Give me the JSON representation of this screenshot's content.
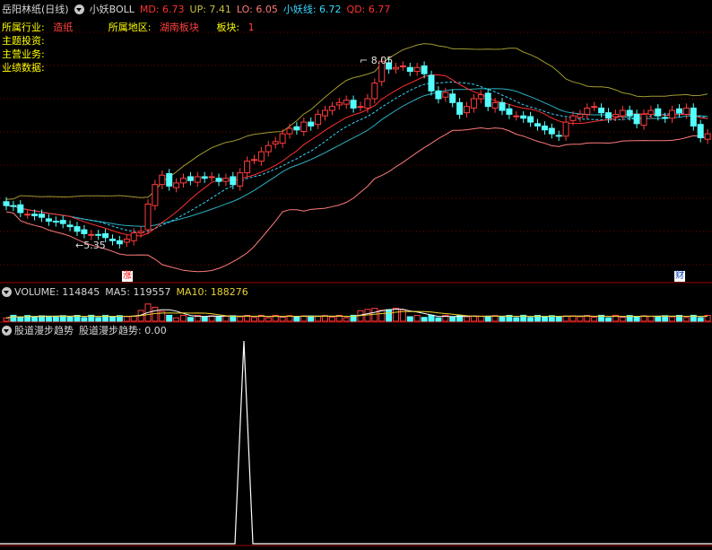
{
  "header": {
    "stock_title": "岳阳林纸(日线)",
    "indicator_name": "小妖BOLL",
    "md": "MD: 6.73",
    "up": "UP: 7.41",
    "lo": "LO: 6.05",
    "xy": "小妖线: 6.72",
    "qd": "QD: 6.77"
  },
  "info": {
    "industry_label": "所属行业:",
    "industry_value": "造纸",
    "region_label": "所属地区:",
    "region_value": "湖南板块",
    "board_label": "板块:",
    "board_value": "1",
    "theme_label": "主题投资:",
    "business_label": "主营业务:",
    "performance_label": "业绩数据:"
  },
  "markers": {
    "high_label": "8.05",
    "low_label": "5.35",
    "zhang_badge": "涨",
    "cai_badge": "财"
  },
  "volume_panel": {
    "volume": "VOLUME: 114845",
    "ma5": "MA5: 119557",
    "ma10": "MA10: 188276"
  },
  "trend_panel": {
    "title": "股道漫步趋势",
    "value_label": "股道漫步趋势: 0.00"
  },
  "colors": {
    "up": "#ff3c3c",
    "down": "#54ffff",
    "md_line": "#ff3030",
    "up_band": "#a09a30",
    "lo_band": "#ff7a7a",
    "mid_line": "#2bb0c0",
    "xy_line": "#38d8ff",
    "vol_ma5": "#ffffff",
    "vol_ma10": "#e8d030",
    "trend_line": "#ffffff",
    "grid": "#7a0000"
  },
  "chart_data": [
    {
      "type": "candlestick",
      "title": "小妖BOLL",
      "series_names": [
        "MD",
        "UP",
        "LO",
        "小妖线",
        "QD"
      ],
      "ylim": [
        5.0,
        8.45
      ],
      "high_marker": 8.05,
      "low_marker": 5.35,
      "closes": [
        5.93,
        5.92,
        5.84,
        5.82,
        5.8,
        5.78,
        5.73,
        5.72,
        5.7,
        5.66,
        5.6,
        5.57,
        5.56,
        5.55,
        5.52,
        5.48,
        5.44,
        5.5,
        5.58,
        5.6,
        5.95,
        6.2,
        6.32,
        6.18,
        6.22,
        6.28,
        6.25,
        6.3,
        6.28,
        6.3,
        6.24,
        6.28,
        6.2,
        6.35,
        6.5,
        6.52,
        6.62,
        6.7,
        6.75,
        6.85,
        6.92,
        6.9,
        7.0,
        6.95,
        7.1,
        7.15,
        7.2,
        7.25,
        7.28,
        7.18,
        7.2,
        7.3,
        7.5,
        7.78,
        7.68,
        7.7,
        7.72,
        7.65,
        7.7,
        7.62,
        7.4,
        7.3,
        7.38,
        7.25,
        7.1,
        7.2,
        7.3,
        7.35,
        7.2,
        7.25,
        7.15,
        7.1,
        7.08,
        7.05,
        7.0,
        6.95,
        6.9,
        6.85,
        6.82,
        7.0,
        7.08,
        7.1,
        7.18,
        7.2,
        7.12,
        7.05,
        7.1,
        7.15,
        7.08,
        6.98,
        7.1,
        7.15,
        7.08,
        7.05,
        7.15,
        7.12,
        7.18,
        6.95,
        6.8,
        6.85
      ]
    },
    {
      "type": "bar",
      "title": "VOLUME",
      "series_names": [
        "VOLUME",
        "MA5",
        "MA10"
      ],
      "volume": 114845,
      "ma5": 119557,
      "ma10": 188276
    },
    {
      "type": "line",
      "title": "股道漫步趋势",
      "value": 0.0
    }
  ]
}
